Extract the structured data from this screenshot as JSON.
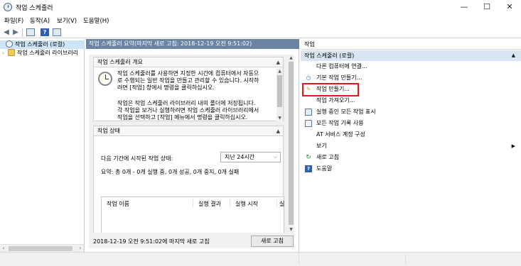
{
  "window": {
    "title": "작업 스케줄러",
    "controls": {
      "minimize": "—",
      "maximize": "☐",
      "close": "✕"
    }
  },
  "menu": [
    "파일(F)",
    "동작(A)",
    "보기(V)",
    "도움말(H)"
  ],
  "tree": [
    {
      "label": "작업 스케줄러 (로컬)"
    },
    {
      "label": "작업 스케줄러 라이브러리"
    }
  ],
  "middle": {
    "header": "작업 스케줄러 요약(마지막 새로 고침: 2018-12-19 오전 9:51:02)",
    "overview": {
      "title": "작업 스케줄러 개요",
      "lines": [
        "작업 스케줄러를 사용하면 지정한 시간에 컴퓨터에서 자동으",
        "로 수행되는 일반 작업을 만들고 관리할 수 있습니다. 시작하",
        "려면 [작업] 창에서 명령을 클릭하십시오.",
        "",
        "작업은 작업 스케줄러 라이브러리 내의 폴더에 저장됩니다.",
        "각 작업을 보거나 실행하려면 작업 스케줄러 라이브러리에서",
        "작업을 선택하고 [작업] 메뉴에서 명령을 클릭하십시오."
      ]
    },
    "status": {
      "title": "작업 상태",
      "label": "다음 기간에 시작된 작업 상태:",
      "period": "지난 24시간",
      "summary": "요약: 총 0개 - 0개 실행 중, 0개 성공, 0개 중지, 0개 실패",
      "columns": [
        "작업 이름",
        "실행 결과",
        "실행 시작",
        "실"
      ]
    },
    "footer": {
      "text": "2018-12-19 오전 9:51:02에 마지막 새로 고침",
      "refresh_label": "새로 고침"
    }
  },
  "actions": {
    "title": "작업",
    "group": "작업 스케줄러 (로컬)",
    "items": [
      {
        "label": "다른 컴퓨터에 연결...",
        "icon": "none"
      },
      {
        "label": "기본 작업 만들기...",
        "icon": "basic-task-icon"
      },
      {
        "label": "작업 만들기...",
        "icon": "create-task-icon"
      },
      {
        "label": "작업 가져오기...",
        "icon": "none"
      },
      {
        "label": "실행 중인 모든 작업 표시",
        "icon": "running-tasks-icon"
      },
      {
        "label": "모든 작업 기록 사용",
        "icon": "history-icon"
      },
      {
        "label": "AT 서비스 계정 구성",
        "icon": "none"
      },
      {
        "label": "보기",
        "icon": "none"
      },
      {
        "label": "새로 고침",
        "icon": "refresh-icon"
      },
      {
        "label": "도움말",
        "icon": "help-icon"
      }
    ]
  },
  "colors": {
    "header_bg": "#6b84a3",
    "selected_row": "#cce4f7",
    "action_group": "#d9e5f3",
    "highlight": "#e3161c"
  }
}
